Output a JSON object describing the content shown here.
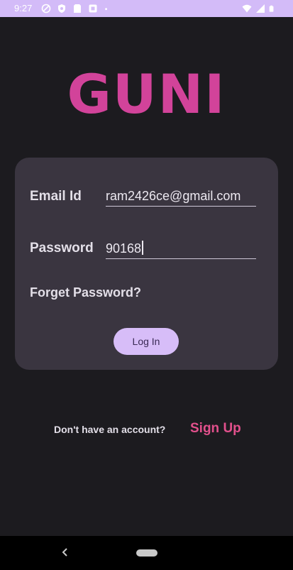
{
  "status_bar": {
    "time": "9:27",
    "left_icons": [
      "shield-outline-icon",
      "shield-icon",
      "sim-card-icon",
      "app-notification-icon",
      "dot-icon"
    ],
    "right_icons": [
      "wifi-icon",
      "signal-icon",
      "battery-icon"
    ],
    "background": "#d3bbf8"
  },
  "logo": {
    "text": "GUNI",
    "color": "#d2439a"
  },
  "login_form": {
    "email_label": "Email Id",
    "email_value": "ram2426ce@gmail.com",
    "password_label": "Password",
    "password_value": "90168",
    "forget_password": "Forget Password?",
    "login_button": "Log In"
  },
  "signup": {
    "prompt": "Don't have an account?",
    "link": "Sign Up",
    "link_color": "#e2508c"
  },
  "nav_bar": {
    "icons": [
      "back-icon",
      "home-pill-icon"
    ]
  }
}
